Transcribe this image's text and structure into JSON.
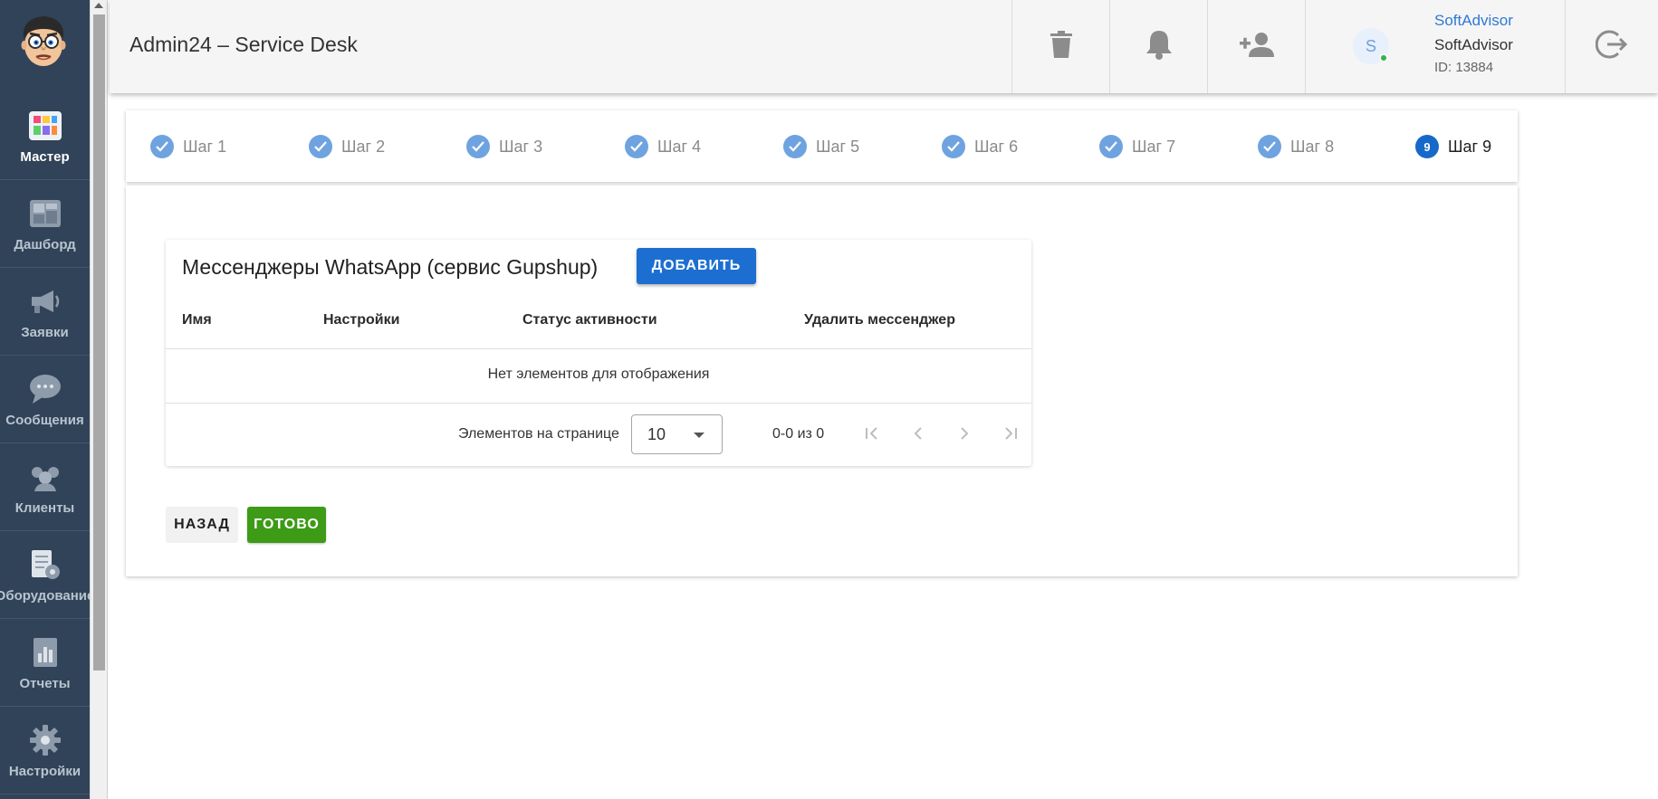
{
  "app": {
    "title": "Admin24 – Service Desk"
  },
  "sidebar": {
    "items": [
      {
        "label": "Мастер",
        "icon": "wizard-icon"
      },
      {
        "label": "Дашборд",
        "icon": "dashboard-icon"
      },
      {
        "label": "Заявки",
        "icon": "megaphone-icon"
      },
      {
        "label": "Сообщения",
        "icon": "chat-bubble-icon"
      },
      {
        "label": "Клиенты",
        "icon": "clients-icon"
      },
      {
        "label": "Оборудование",
        "icon": "equipment-icon"
      },
      {
        "label": "Отчеты",
        "icon": "reports-icon"
      },
      {
        "label": "Настройки",
        "icon": "gear-icon"
      }
    ],
    "active_index": 0
  },
  "header": {
    "icons": [
      "trash-icon",
      "bell-icon",
      "add-user-icon",
      "logout-icon"
    ],
    "user": {
      "avatar_letter": "S",
      "link": "SoftAdvisor",
      "name": "SoftAdvisor",
      "id": "ID: 13884",
      "status": "online"
    }
  },
  "stepper": {
    "steps": [
      {
        "label": "Шаг 1",
        "state": "done"
      },
      {
        "label": "Шаг 2",
        "state": "done"
      },
      {
        "label": "Шаг 3",
        "state": "done"
      },
      {
        "label": "Шаг 4",
        "state": "done"
      },
      {
        "label": "Шаг 5",
        "state": "done"
      },
      {
        "label": "Шаг 6",
        "state": "done"
      },
      {
        "label": "Шаг 7",
        "state": "done"
      },
      {
        "label": "Шаг 8",
        "state": "done"
      },
      {
        "label": "Шаг 9",
        "state": "current",
        "number": "9"
      }
    ]
  },
  "messengers": {
    "title": "Мессенджеры WhatsApp (сервис Gupshup)",
    "add_label": "ДОБАВИТЬ",
    "columns": [
      "Имя",
      "Настройки",
      "Статус активности",
      "Удалить мессенджер"
    ],
    "empty_message": "Нет элементов для отображения",
    "pagination": {
      "per_page_label": "Элементов на странице",
      "per_page_value": "10",
      "range": "0-0 из 0"
    }
  },
  "actions": {
    "back_label": "НАЗАД",
    "done_label": "ГОТОВО"
  },
  "colors": {
    "sidebar_bg": "#304358",
    "accent": "#1c6fd1",
    "step_done": "#6fa3e0",
    "step_current": "#1669c9",
    "done_button": "#3d9b16",
    "online": "#34b34a"
  }
}
